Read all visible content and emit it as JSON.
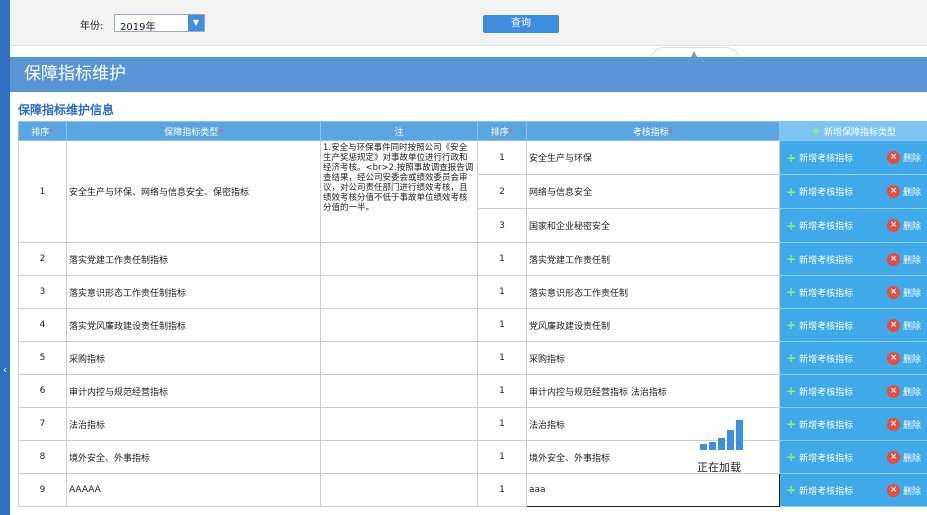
{
  "filter": {
    "year_label": "年份:",
    "year_value": "2019年",
    "query_label": "查询"
  },
  "page": {
    "title": "保障指标维护",
    "section_title": "保障指标维护信息"
  },
  "table": {
    "headers": {
      "order": "排序",
      "type": "保障指标类型",
      "note": "注",
      "order2": "排序",
      "assess": "考核指标",
      "add_type": "新增保障指标类型"
    },
    "required_mark": "*",
    "action_add": "新增考核指标",
    "action_delete": "删除",
    "rows": [
      {
        "order": "1",
        "type": "安全生产与环保、网络与信息安全、保密指标",
        "note": "1.安全与环保事件同时按照公司《安全生产奖惩规定》对事故单位进行行政和经济考核。<br>2.按照事故调查报告调查结果，经公司安委会或绩效委员会审议，对公司责任部门进行绩效考核，且绩效考核分值不低于事故单位绩效考核分值的一半。",
        "items": [
          {
            "order": "1",
            "name": "安全生产与环保"
          },
          {
            "order": "2",
            "name": "网络与信息安全"
          },
          {
            "order": "3",
            "name": "国家和企业秘密安全"
          }
        ]
      },
      {
        "order": "2",
        "type": "落实党建工作责任制指标",
        "note": "",
        "items": [
          {
            "order": "1",
            "name": "落实党建工作责任制"
          }
        ]
      },
      {
        "order": "3",
        "type": "落实意识形态工作责任制指标",
        "note": "",
        "items": [
          {
            "order": "1",
            "name": "落实意识形态工作责任制"
          }
        ]
      },
      {
        "order": "4",
        "type": "落实党风廉政建设责任制指标",
        "note": "",
        "items": [
          {
            "order": "1",
            "name": "党风廉政建设责任制"
          }
        ]
      },
      {
        "order": "5",
        "type": "采购指标",
        "note": "",
        "items": [
          {
            "order": "1",
            "name": "采购指标"
          }
        ]
      },
      {
        "order": "6",
        "type": "审计内控与规范经营指标",
        "note": "",
        "items": [
          {
            "order": "1",
            "name": "审计内控与规范经营指标 法治指标"
          }
        ]
      },
      {
        "order": "7",
        "type": "法治指标",
        "note": "",
        "items": [
          {
            "order": "1",
            "name": "法治指标"
          }
        ]
      },
      {
        "order": "8",
        "type": "境外安全、外事指标",
        "note": "",
        "items": [
          {
            "order": "1",
            "name": "境外安全、外事指标"
          }
        ]
      },
      {
        "order": "9",
        "type": "AAAAA",
        "note": "",
        "items": [
          {
            "order": "1",
            "name": "aaa"
          }
        ]
      }
    ]
  },
  "loading": {
    "text": "正在加载"
  },
  "colors": {
    "accent": "#3d8fe0",
    "header_bar": "#5a95d8",
    "action_bg": "#3fa9ea",
    "delete_red": "#e74c3c",
    "plus_green": "#8af07a"
  },
  "icons": {
    "dropdown": "chevron-down-icon",
    "add": "plus-icon",
    "delete": "close-circle-icon",
    "collapse": "chevron-left-icon"
  }
}
